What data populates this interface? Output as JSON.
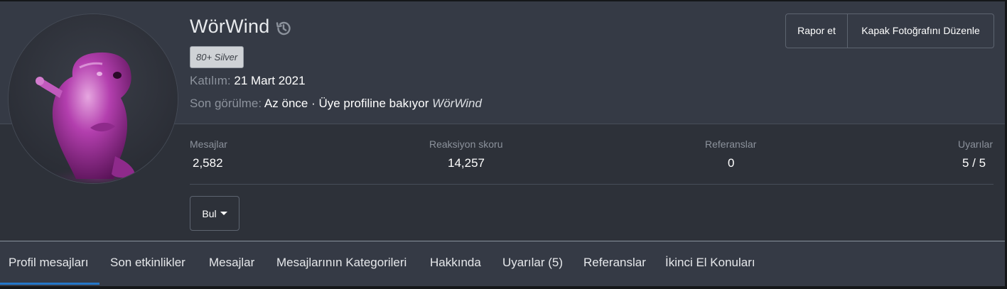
{
  "profile": {
    "username": "WörWind",
    "badge": "80+ Silver",
    "joined_label": "Katılım:",
    "joined_value": "21 Mart 2021",
    "last_seen_label": "Son görülme:",
    "last_seen_value": "Az önce · Üye profiline bakıyor",
    "last_seen_user": "WörWind"
  },
  "actions": {
    "report": "Rapor et",
    "edit_cover": "Kapak Fotoğrafını Düzenle",
    "find": "Bul"
  },
  "stats": [
    {
      "label": "Mesajlar",
      "value": "2,582"
    },
    {
      "label": "Reaksiyon skoru",
      "value": "14,257"
    },
    {
      "label": "Referanslar",
      "value": "0"
    },
    {
      "label": "Uyarılar",
      "value": "5 / 5"
    }
  ],
  "tabs": [
    {
      "label": "Profil mesajları",
      "active": true
    },
    {
      "label": "Son etkinlikler"
    },
    {
      "label": "Mesajlar"
    },
    {
      "label": "Mesajlarının Kategorileri"
    },
    {
      "label": "Hakkında"
    },
    {
      "label": "Uyarılar (5)"
    },
    {
      "label": "Referanslar"
    },
    {
      "label": "İkinci El Konuları"
    }
  ],
  "colors": {
    "background": "#2d3139",
    "header": "#353a45",
    "accent": "#2577c8",
    "muted_text": "#8c929c",
    "badge_bg": "#cfd2d6"
  },
  "icons": {
    "history": "history-icon",
    "dropdown": "caret-down-icon"
  }
}
